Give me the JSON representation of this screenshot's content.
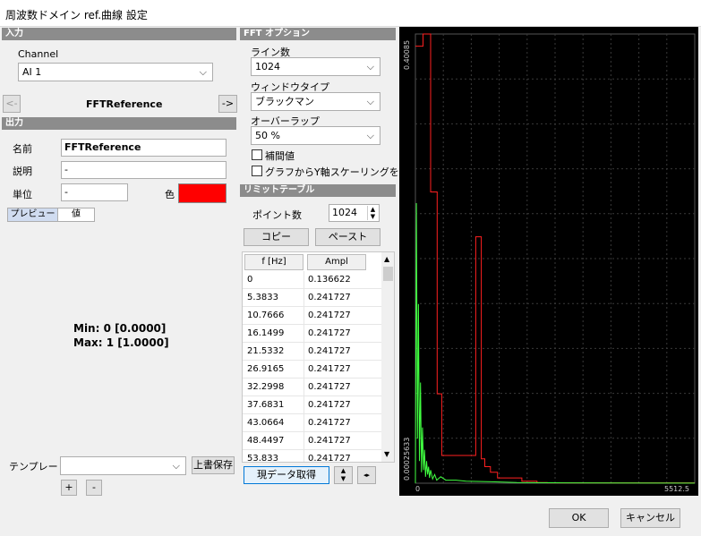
{
  "window": {
    "title": "周波数ドメイン ref.曲線 設定"
  },
  "input_section": {
    "header": "入力",
    "channel_label": "Channel",
    "channel_value": "AI 1",
    "nav_prev": "<-",
    "nav_next": "->",
    "reference_name": "FFTReference"
  },
  "output_section": {
    "header": "出力",
    "name_label": "名前",
    "name_value": "FFTReference",
    "desc_label": "説明",
    "desc_value": "-",
    "unit_label": "単位",
    "unit_value": "-",
    "color_label": "色",
    "color_value": "#ff0000",
    "tab_preview": "プレビュー",
    "tab_value": "値",
    "min_text": "Min: 0 [0.0000]",
    "max_text": "Max: 1 [1.0000]"
  },
  "template": {
    "label": "テンプレート",
    "value": "",
    "overwrite_button": "上書保存",
    "add_button": "+",
    "remove_button": "-"
  },
  "fft_options": {
    "header": "FFT オプション",
    "lines_label": "ライン数",
    "lines_value": "1024",
    "window_label": "ウィンドウタイプ",
    "window_value": "ブラックマン",
    "overlap_label": "オーバーラップ",
    "overlap_value": "50 %",
    "interp_label": "補間値",
    "interp_checked": false,
    "yscale_label": "グラフからY軸スケーリングをスキ",
    "yscale_checked": false
  },
  "limit_table": {
    "header": "リミットテーブル",
    "points_label": "ポイント数",
    "points_value": "1024",
    "copy_button": "コピー",
    "paste_button": "ペースト",
    "columns": [
      "f [Hz]",
      "Ampl"
    ],
    "rows": [
      [
        "0",
        "0.136622"
      ],
      [
        "5.3833",
        "0.241727"
      ],
      [
        "10.7666",
        "0.241727"
      ],
      [
        "16.1499",
        "0.241727"
      ],
      [
        "21.5332",
        "0.241727"
      ],
      [
        "26.9165",
        "0.241727"
      ],
      [
        "32.2998",
        "0.241727"
      ],
      [
        "37.6831",
        "0.241727"
      ],
      [
        "43.0664",
        "0.241727"
      ],
      [
        "48.4497",
        "0.241727"
      ],
      [
        "53.833",
        "0.241727"
      ]
    ],
    "get_current_button": "現データ取得"
  },
  "chart_data": {
    "type": "line",
    "y_axis_top_label": "0.40085",
    "y_axis_bottom_label": "0.00025633",
    "x_axis_left_label": "0",
    "x_axis_right_label": "5512.5",
    "xlim": [
      0,
      5512.5
    ],
    "ylim": [
      0.00025633,
      0.40085
    ],
    "grid": true,
    "series": [
      {
        "color": "#ff2020",
        "x": [
          0,
          150,
          150,
          300,
          300,
          430,
          430,
          520,
          520,
          560,
          560,
          620,
          620,
          1190,
          1190,
          1300,
          1300,
          1370,
          1370,
          1480,
          1480,
          1620,
          1620,
          2100,
          2100,
          2400,
          2400,
          2600,
          2600,
          5512.5
        ],
        "y": [
          0.39,
          0.39,
          0.40085,
          0.40085,
          0.26,
          0.26,
          0.08,
          0.08,
          0.025,
          0.025,
          0.025,
          0.025,
          0.025,
          0.025,
          0.22,
          0.22,
          0.022,
          0.022,
          0.015,
          0.015,
          0.01,
          0.01,
          0.005,
          0.005,
          0.002,
          0.002,
          0.0008,
          0.0008,
          0.0006,
          0.0006
        ]
      },
      {
        "color": "#40ff40",
        "x": [
          0,
          20,
          40,
          60,
          80,
          100,
          120,
          140,
          160,
          180,
          200,
          220,
          240,
          260,
          280,
          300,
          340,
          380,
          420,
          500,
          600,
          800,
          1000,
          1500,
          2000,
          3000,
          4000,
          5512.5
        ],
        "y": [
          0.0003,
          0.25,
          0.04,
          0.16,
          0.02,
          0.09,
          0.01,
          0.05,
          0.012,
          0.03,
          0.006,
          0.02,
          0.008,
          0.015,
          0.005,
          0.012,
          0.004,
          0.008,
          0.003,
          0.006,
          0.003,
          0.003,
          0.002,
          0.0015,
          0.0008,
          0.0006,
          0.0004,
          0.0003
        ]
      }
    ]
  },
  "footer": {
    "ok_button": "OK",
    "cancel_button": "キャンセル"
  }
}
